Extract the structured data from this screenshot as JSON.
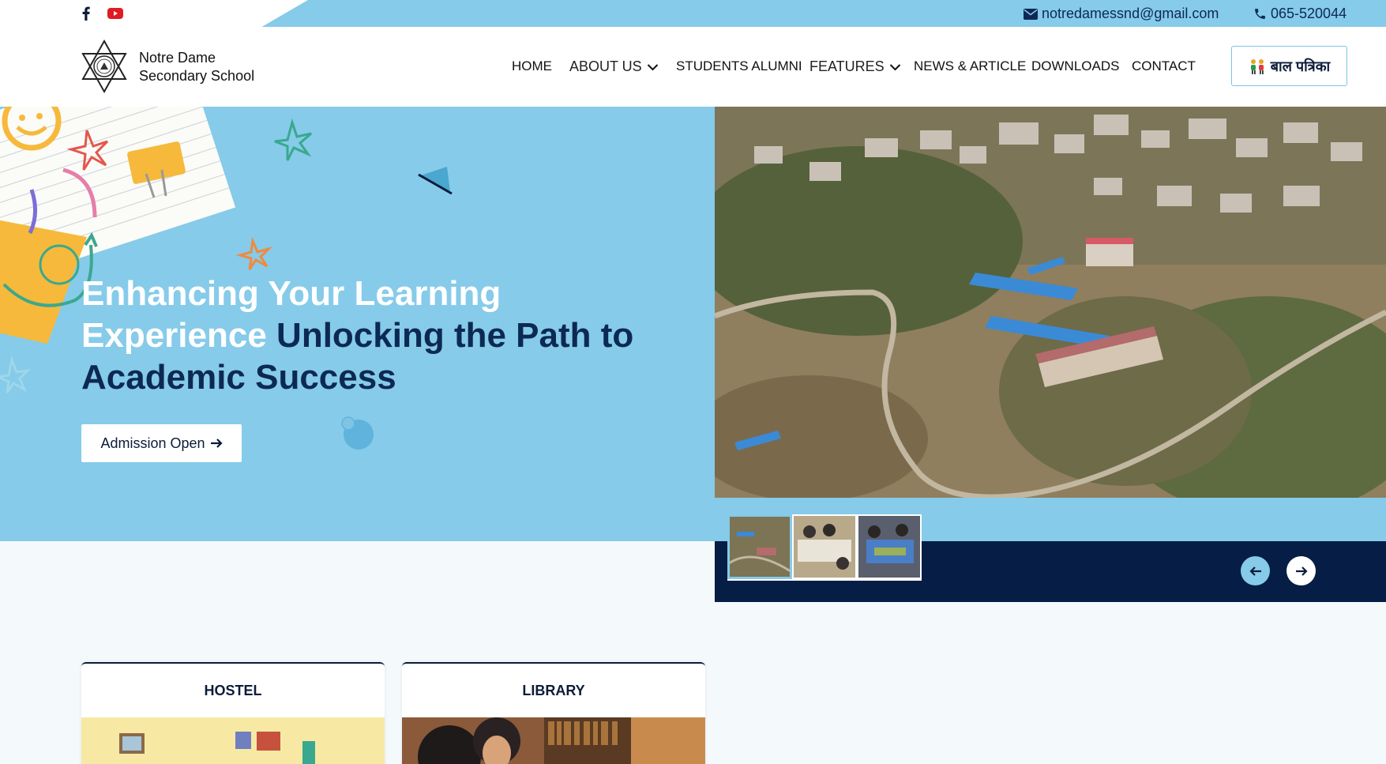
{
  "topbar": {
    "social": [
      "facebook-icon",
      "youtube-icon"
    ],
    "email": "notredamessnd@gmail.com",
    "phone": "065-520044"
  },
  "header": {
    "school_name_line1": "Notre Dame",
    "school_name_line2": "Secondary School",
    "nav": {
      "home": "HOME",
      "about": "ABOUT US",
      "alumni": "STUDENTS ALUMNI",
      "features": "FEATURES",
      "news": "NEWS & ARTICLE",
      "downloads": "DOWNLOADS",
      "contact": "CONTACT"
    },
    "balpatrika_label": "बाल पत्रिका"
  },
  "hero": {
    "title_light": "Enhancing Your Learning Experience",
    "title_dark": "Unlocking the Path to Academic Success",
    "cta_label": "Admission Open"
  },
  "slider": {
    "thumbnail_count": 3,
    "active_index": 0
  },
  "cards": {
    "hostel": "HOSTEL",
    "library": "LIBRARY"
  },
  "colors": {
    "sky": "#86cbe9",
    "navy": "#061d46",
    "dark_text": "#0c2954"
  }
}
